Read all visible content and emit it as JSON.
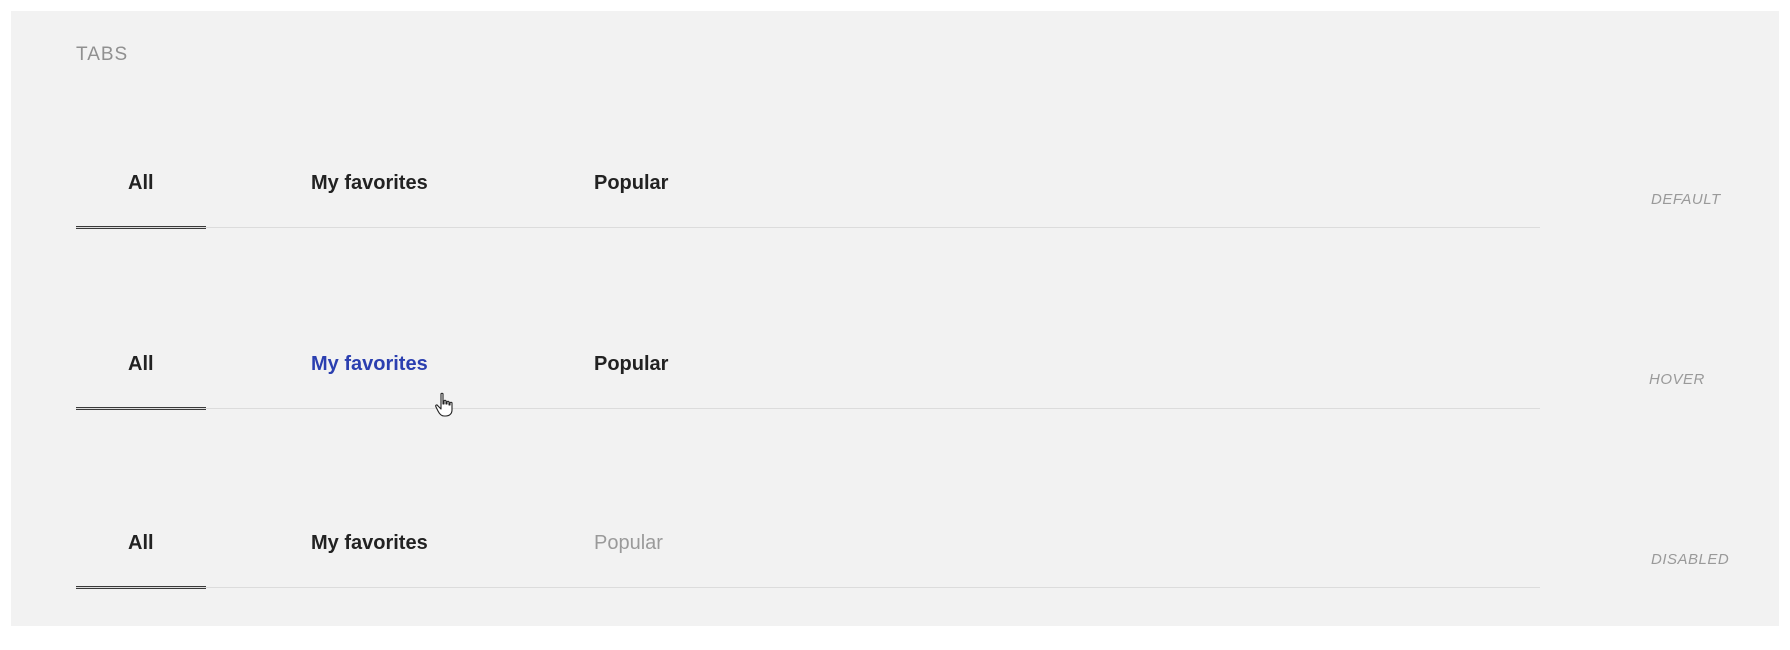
{
  "section": {
    "title": "TABS"
  },
  "rows": [
    {
      "state": "DEFAULT",
      "tabs": [
        {
          "label": "All"
        },
        {
          "label": "My favorites"
        },
        {
          "label": "Popular"
        }
      ]
    },
    {
      "state": "HOVER",
      "tabs": [
        {
          "label": "All"
        },
        {
          "label": "My favorites"
        },
        {
          "label": "Popular"
        }
      ]
    },
    {
      "state": "DISABLED",
      "tabs": [
        {
          "label": "All"
        },
        {
          "label": "My favorites"
        },
        {
          "label": "Popular"
        }
      ]
    }
  ],
  "colors": {
    "panel_bg": "#f2f2f2",
    "text": "#222222",
    "hover_text": "#2b3fb0",
    "disabled_text": "#9a9a9a",
    "active_indicator": "#3a3a3a",
    "divider": "#dcdcdc"
  },
  "icons": {
    "pointer": "hand-pointer-icon"
  }
}
